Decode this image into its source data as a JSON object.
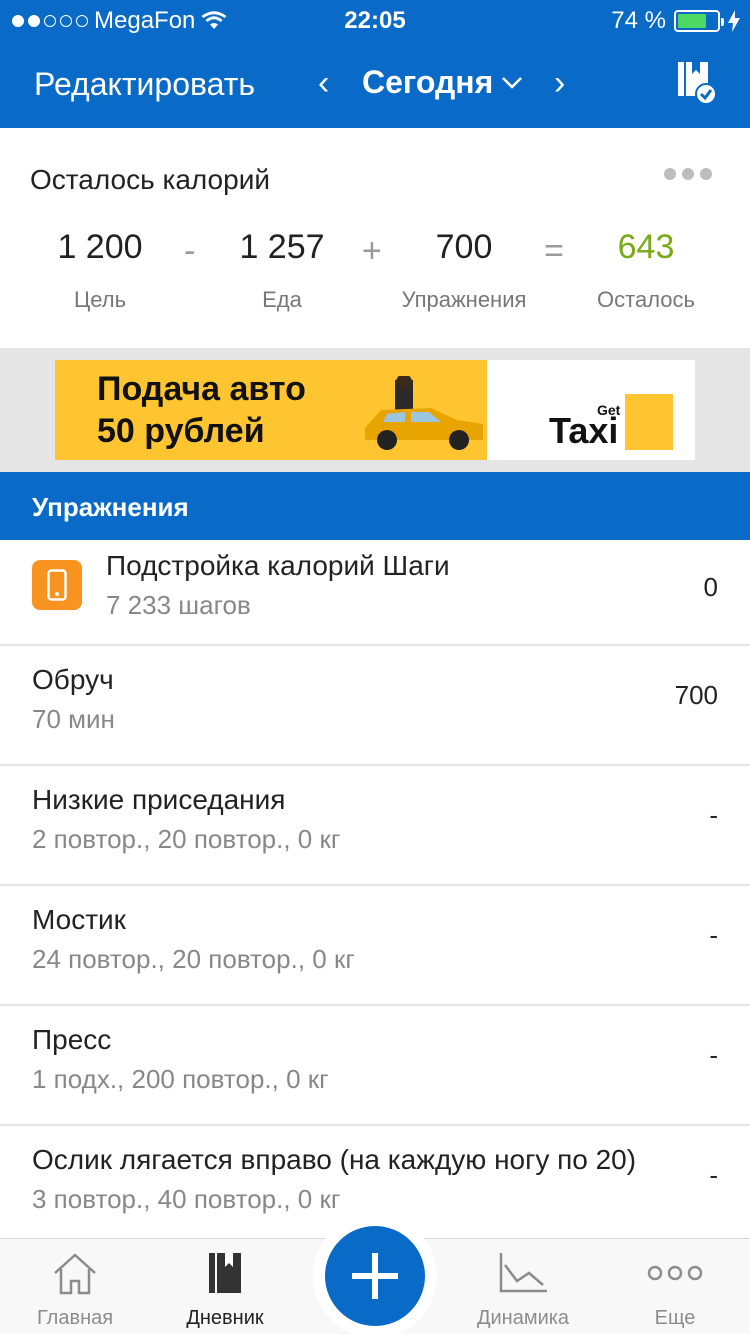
{
  "status_bar": {
    "carrier": "MegaFon",
    "time": "22:05",
    "battery_percent": "74 %",
    "battery_level": 0.74,
    "signal_bars": 2
  },
  "nav": {
    "edit_label": "Редактировать",
    "prev_icon": "chevron-left-icon",
    "prev_glyph": "‹",
    "title": "Сегодня",
    "next_icon": "chevron-right-icon",
    "next_glyph": "›",
    "action_icon": "bookmark-check-icon"
  },
  "calories": {
    "heading": "Осталось калорий",
    "goal": {
      "value": "1 200",
      "label": "Цель"
    },
    "food": {
      "value": "1 257",
      "label": "Еда"
    },
    "exercise": {
      "value": "700",
      "label": "Упражнения"
    },
    "remaining": {
      "value": "643",
      "label": "Осталось"
    },
    "ops": {
      "minus": "-",
      "plus": "+",
      "equals": "="
    },
    "remaining_color": "#7aaa16"
  },
  "ad": {
    "line1": "Подача авто",
    "line2": "50 рублей",
    "brand_get": "Get",
    "brand_name": "Taxi"
  },
  "section": {
    "title": "Упражнения"
  },
  "exercises": [
    {
      "name": "Подстройка калорий Шаги",
      "detail": "7 233 шагов",
      "value": "0",
      "icon": "phone-icon"
    },
    {
      "name": "Обруч",
      "detail": "70 мин",
      "value": "700"
    },
    {
      "name": "Низкие приседания",
      "detail": "2 повтор., 20 повтор., 0 кг",
      "value": "-"
    },
    {
      "name": "Мостик",
      "detail": "24 повтор., 20 повтор., 0 кг",
      "value": "-"
    },
    {
      "name": "Пресс",
      "detail": "1 подх., 200 повтор., 0 кг",
      "value": "-"
    },
    {
      "name": "Ослик лягается вправо (на каждую ногу по 20)",
      "detail": "3 повтор., 40 повтор., 0 кг",
      "value": "-"
    }
  ],
  "tabbar": {
    "home": "Главная",
    "diary": "Дневник",
    "progress": "Динамика",
    "more": "Еще"
  },
  "colors": {
    "brand_blue": "#0a6ac7",
    "accent_orange": "#f7931e",
    "ad_yellow": "#fec530"
  }
}
